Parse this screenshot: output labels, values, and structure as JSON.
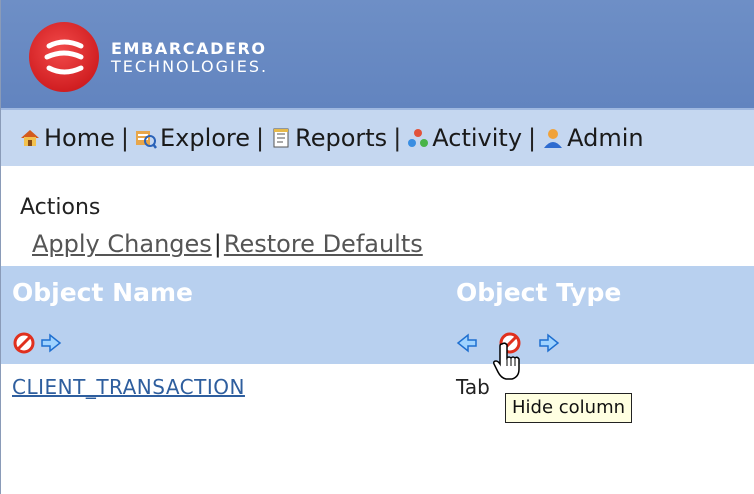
{
  "header": {
    "logo_line1": "EMBARCADERO",
    "logo_line2": "TECHNOLOGIES."
  },
  "nav": {
    "items": [
      {
        "label": "Home",
        "icon": "home-icon"
      },
      {
        "label": "Explore",
        "icon": "explore-icon"
      },
      {
        "label": "Reports",
        "icon": "reports-icon"
      },
      {
        "label": "Activity",
        "icon": "activity-icon"
      },
      {
        "label": "Admin",
        "icon": "admin-icon"
      }
    ],
    "separator": "|"
  },
  "actions": {
    "label": "Actions",
    "apply": "Apply Changes",
    "separator": "|",
    "restore": "Restore Defaults"
  },
  "table": {
    "columns": [
      {
        "title": "Object Name"
      },
      {
        "title": "Object Type"
      }
    ],
    "rows": [
      {
        "name": "CLIENT_TRANSACTION",
        "type": "Tab"
      }
    ]
  },
  "tooltip": {
    "text": "Hide column"
  },
  "colors": {
    "header_blue": "#6284bf",
    "nav_bg": "#c5d7f0",
    "table_header_bg": "#b8d0ef",
    "link": "#2e5e9e",
    "hide_red": "#e0301e",
    "arrow_blue": "#1e88e5"
  }
}
